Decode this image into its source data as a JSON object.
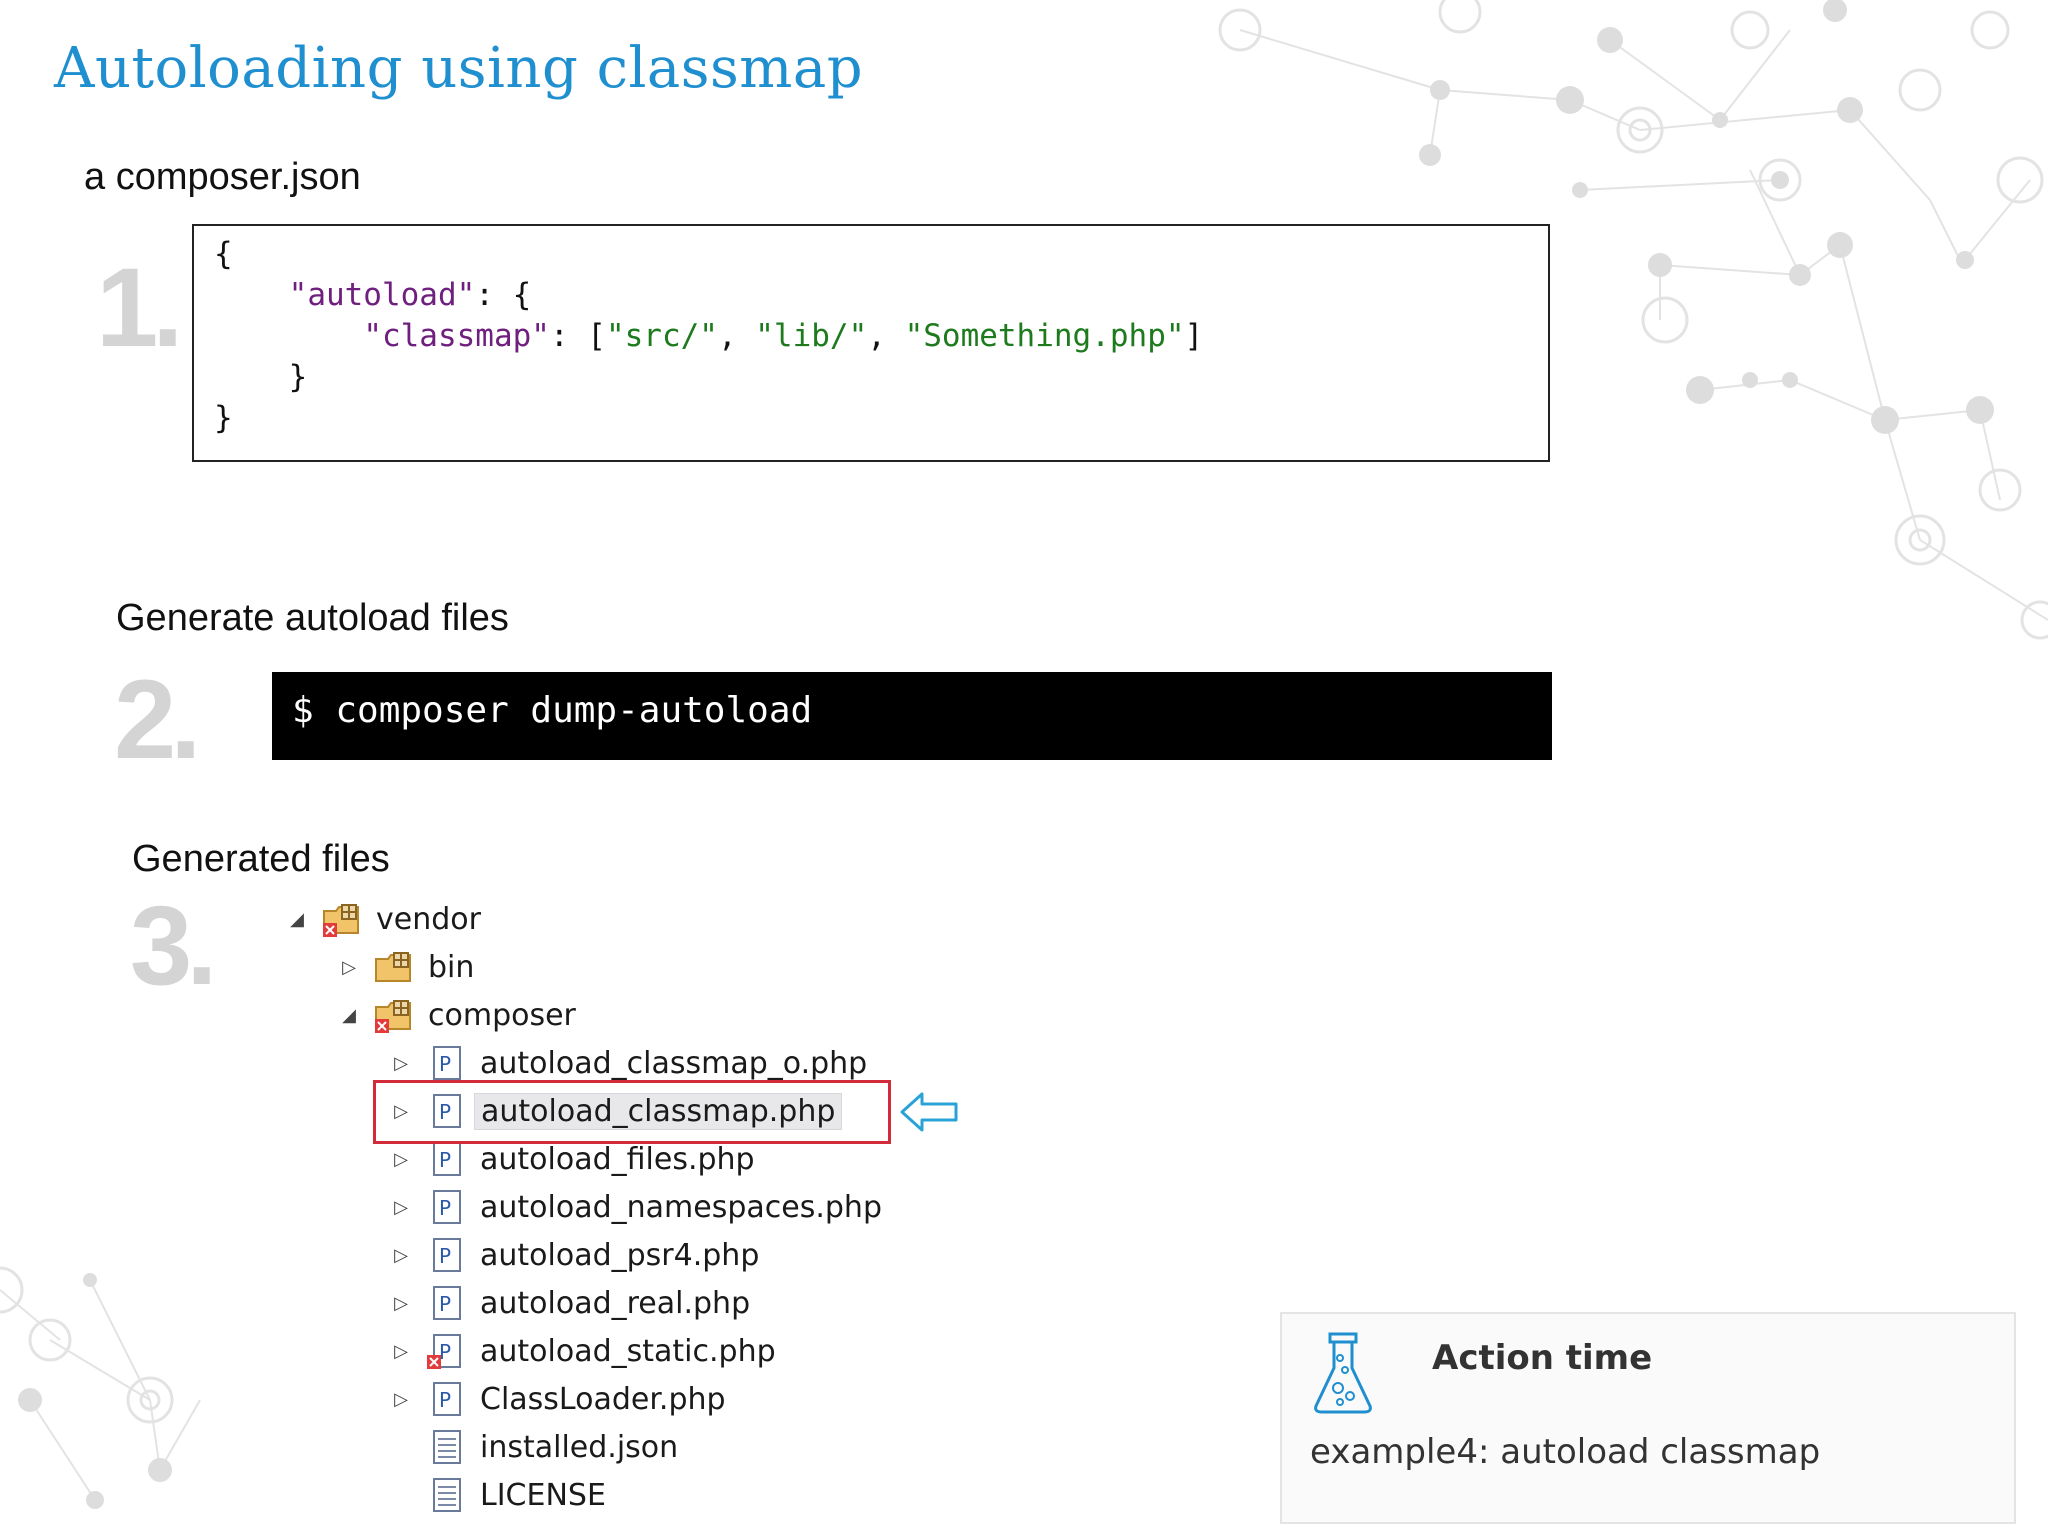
{
  "slide": {
    "title": "Autoloading using classmap"
  },
  "steps": [
    {
      "number": "1.",
      "label": "a composer.json"
    },
    {
      "number": "2.",
      "label": "Generate autoload files"
    },
    {
      "number": "3.",
      "label": "Generated files"
    }
  ],
  "code": {
    "line1": "{",
    "autoload_key": "\"autoload\"",
    "line2_rest": ": {",
    "classmap_key": "\"classmap\"",
    "classmap_mid": ": [",
    "src": "\"src/\"",
    "lib": "\"lib/\"",
    "something": "\"Something.php\"",
    "comma": ", ",
    "close_bracket": "]",
    "inner_close": "}",
    "outer_close": "}"
  },
  "terminal": {
    "command": "$ composer dump-autoload"
  },
  "tree": {
    "vendor": "vendor",
    "bin": "bin",
    "composer": "composer",
    "files": [
      "autoload_classmap_o.php",
      "autoload_classmap.php",
      "autoload_files.php",
      "autoload_namespaces.php",
      "autoload_psr4.php",
      "autoload_real.php",
      "autoload_static.php",
      "ClassLoader.php",
      "installed.json",
      "LICENSE"
    ],
    "selected_index": 1
  },
  "action": {
    "title": "Action time",
    "text": "example4: autoload classmap",
    "icon": "flask-icon"
  },
  "colors": {
    "title": "#1f8fd0",
    "keyword": "#6f1f7e",
    "string": "#1d7a1d",
    "highlight": "#d22b3a",
    "arrow": "#29a3d6"
  }
}
